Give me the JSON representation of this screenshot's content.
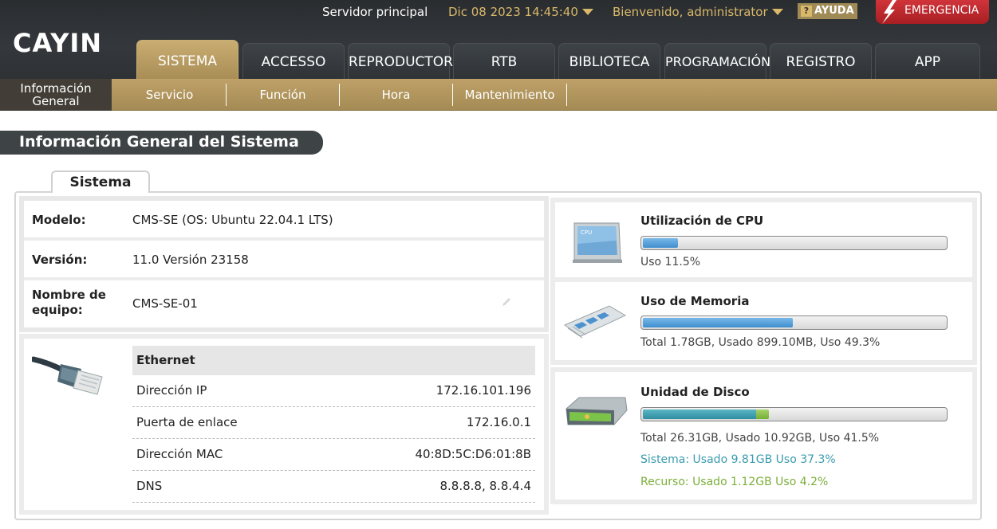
{
  "header": {
    "logo_text": "CAYIN",
    "server": "Servidor principal",
    "datetime": "Dic 08 2023 14:45:40",
    "welcome": "Bienvenido, administrator",
    "help_label": "AYUDA",
    "emergency_label": "EMERGENCIA"
  },
  "nav": [
    "SISTEMA",
    "ACCESSO",
    "REPRODUCTOR",
    "RTB",
    "BIBLIOTECA",
    "PROGRAMACIÓN",
    "REGISTRO",
    "APP"
  ],
  "subnav": [
    "Información General",
    "Servicio",
    "Función",
    "Hora",
    "Mantenimiento"
  ],
  "page_title": "Información General del Sistema",
  "panel_tab": "Sistema",
  "info": {
    "model_label": "Modelo:",
    "model_value": "CMS-SE (OS: Ubuntu 22.04.1 LTS)",
    "version_label": "Versión:",
    "version_value": "11.0 Versión 23158",
    "hostname_label": "Nombre de equipo:",
    "hostname_value": "CMS-SE-01"
  },
  "network": {
    "title": "Ethernet",
    "rows": [
      {
        "label": "Dirección IP",
        "value": "172.16.101.196"
      },
      {
        "label": "Puerta de enlace",
        "value": "172.16.0.1"
      },
      {
        "label": "Dirección MAC",
        "value": "40:8D:5C:D6:01:8B"
      },
      {
        "label": "DNS",
        "value": "8.8.8.8, 8.8.4.4"
      }
    ]
  },
  "cpu": {
    "title": "Utilización de CPU",
    "text": "Uso 11.5%",
    "percent": 11.5,
    "icon_label": "CPU"
  },
  "memory": {
    "title": "Uso de Memoria",
    "text": "Total 1.78GB, Usado 899.10MB, Uso 49.3%",
    "percent": 49.3
  },
  "disk": {
    "title": "Unidad de Disco",
    "text": "Total 26.31GB, Usado 10.92GB, Uso 41.5%",
    "system_text": "Sistema: Usado 9.81GB Uso 37.3%",
    "resource_text": "Recurso: Usado 1.12GB Uso 4.2%",
    "system_percent": 37.3,
    "resource_percent": 4.2
  },
  "colors": {
    "accent_gold": "#bea168",
    "header_dark": "#34383c",
    "emergency_red": "#c0282e",
    "system_teal": "#3a9bb0",
    "resource_green": "#7cae3a"
  }
}
